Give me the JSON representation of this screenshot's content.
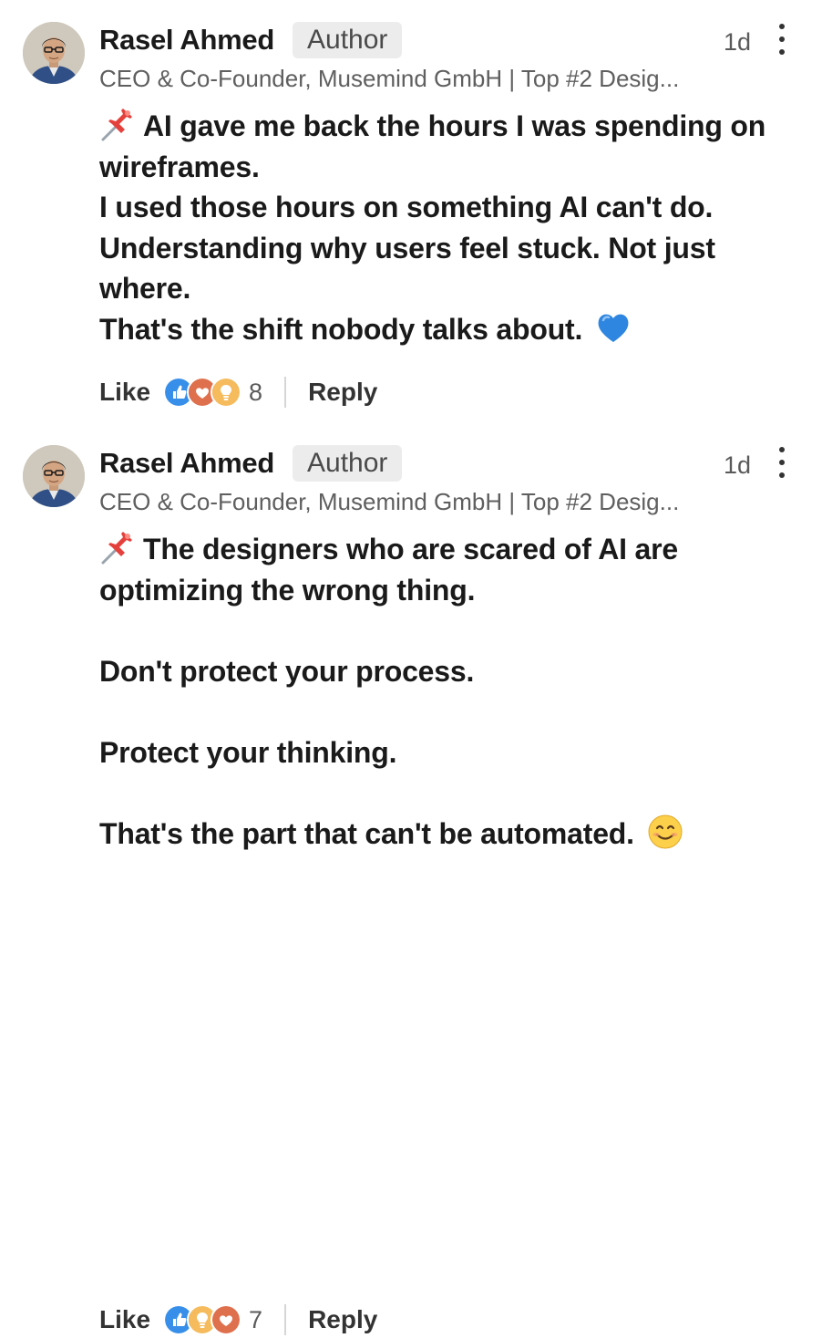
{
  "comments": [
    {
      "author": "Rasel Ahmed",
      "badge": "Author",
      "time": "1d",
      "headline": "CEO & Co-Founder, Musemind GmbH | Top #2 Desig...",
      "lines": [
        "AI gave me back the hours I was spending on",
        "wireframes.",
        "I used those hours on something AI can't do.",
        "Understanding why users feel stuck. Not just",
        "where.",
        "That's the shift nobody talks about."
      ],
      "like_label": "Like",
      "reaction_icons": [
        "like-icon",
        "love-icon",
        "insightful-icon"
      ],
      "reaction_count": "8",
      "reply_label": "Reply"
    },
    {
      "author": "Rasel Ahmed",
      "badge": "Author",
      "time": "1d",
      "headline": "CEO & Co-Founder, Musemind GmbH | Top #2 Desig...",
      "lines": [
        "The designers who are scared of AI are",
        "optimizing the wrong thing.",
        "",
        "Don't protect your process.",
        "",
        "Protect your thinking.",
        "",
        "That's the part that can't be automated."
      ],
      "like_label": "Like",
      "reaction_icons": [
        "like-icon",
        "insightful-icon",
        "love-icon"
      ],
      "reaction_count": "7",
      "reply_label": "Reply"
    }
  ],
  "colors": {
    "like_blue": "#378fe9",
    "love_red": "#df704d",
    "insightful_yellow": "#f5bb5c",
    "badge_bg": "#ececec"
  }
}
